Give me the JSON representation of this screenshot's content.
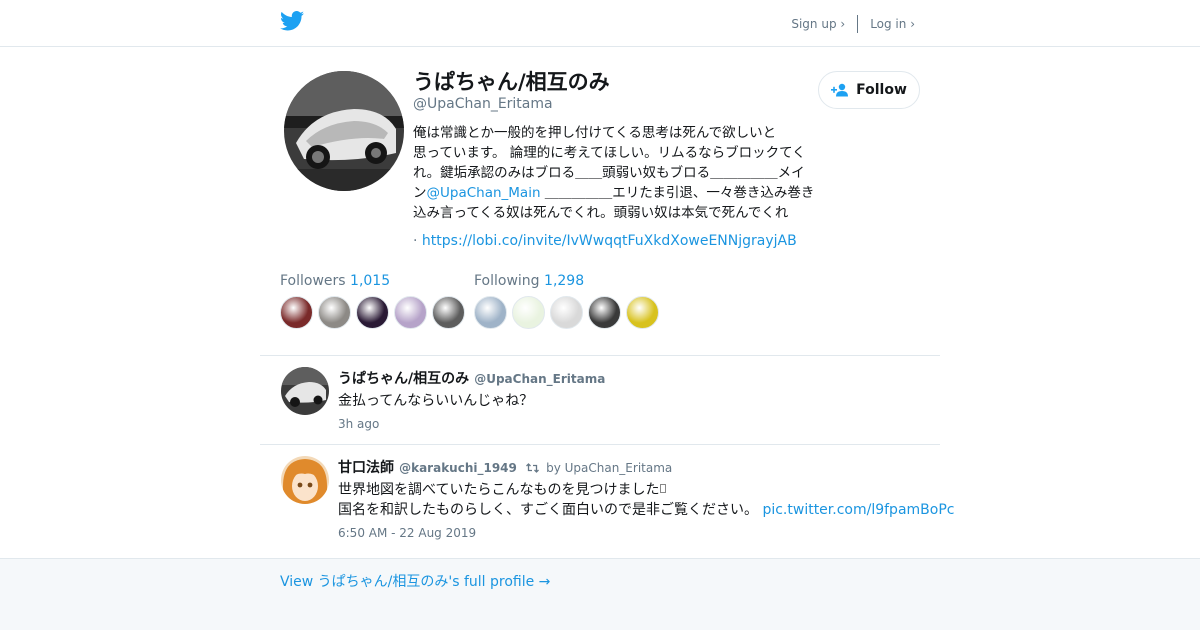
{
  "header": {
    "signup_label": "Sign up ›",
    "login_label": "Log in ›"
  },
  "profile": {
    "name": "うぱちゃん/相互のみ",
    "handle": "@UpaChan_Eritama",
    "bio_line1": "俺は常識とか一般的を押し付けてくる思考は死んで欲しいと",
    "bio_line2": "思っています。 論理的に考えてほしい。リムるならブロックてく",
    "bio_line3": "れ。鍵垢承認のみはブロる＿＿頭弱い奴もブロる＿＿＿＿＿メイ",
    "bio_line4_pre": "ン",
    "bio_mention": "@UpaChan_Main",
    "bio_line4_post": " ＿＿＿＿＿エリたま引退、一々巻き込み巻き",
    "bio_line5": "込み言ってくる奴は死んでくれ。頭弱い奴は本気で死んでくれ",
    "link_prefix": "·",
    "link": "https://lobi.co/invite/IvWwqqtFuXkdXoweENNjgrayjAB",
    "follow_label": "Follow"
  },
  "stats": {
    "followers_label": "Followers",
    "followers_count": "1,015",
    "following_label": "Following",
    "following_count": "1,298"
  },
  "follower_avatars": [
    "#7a2a2a",
    "#8d8a86",
    "#2a1a35",
    "#b6a3c9",
    "#5d5d5d"
  ],
  "following_avatars": [
    "#9fb3c8",
    "#e9f3e0",
    "#d9d9d9",
    "#3a3a3a",
    "#d8c21e"
  ],
  "tweets": [
    {
      "name": "うぱちゃん/相互のみ",
      "handle": "@UpaChan_Eritama",
      "text": "金払ってんならいいんじゃね？",
      "time": "3h ago"
    },
    {
      "name": "甘口法師",
      "handle": "@karakuchi_1949",
      "retweet_by": "by UpaChan_Eritama",
      "text_line1": "世界地図を調べていたらこんなものを見つけました",
      "text_line2": "国名を和訳したものらしく、すごく面白いので是非ご覧ください。",
      "link": "pic.twitter.com/l9fpamBoPc",
      "time": "6:50 AM - 22 Aug 2019"
    }
  ],
  "footer": {
    "full_profile_label": "View うぱちゃん/相互のみ's full profile →"
  },
  "colors": {
    "accent": "#1b95e0",
    "twitter_blue": "#1da1f2",
    "muted": "#657786"
  }
}
